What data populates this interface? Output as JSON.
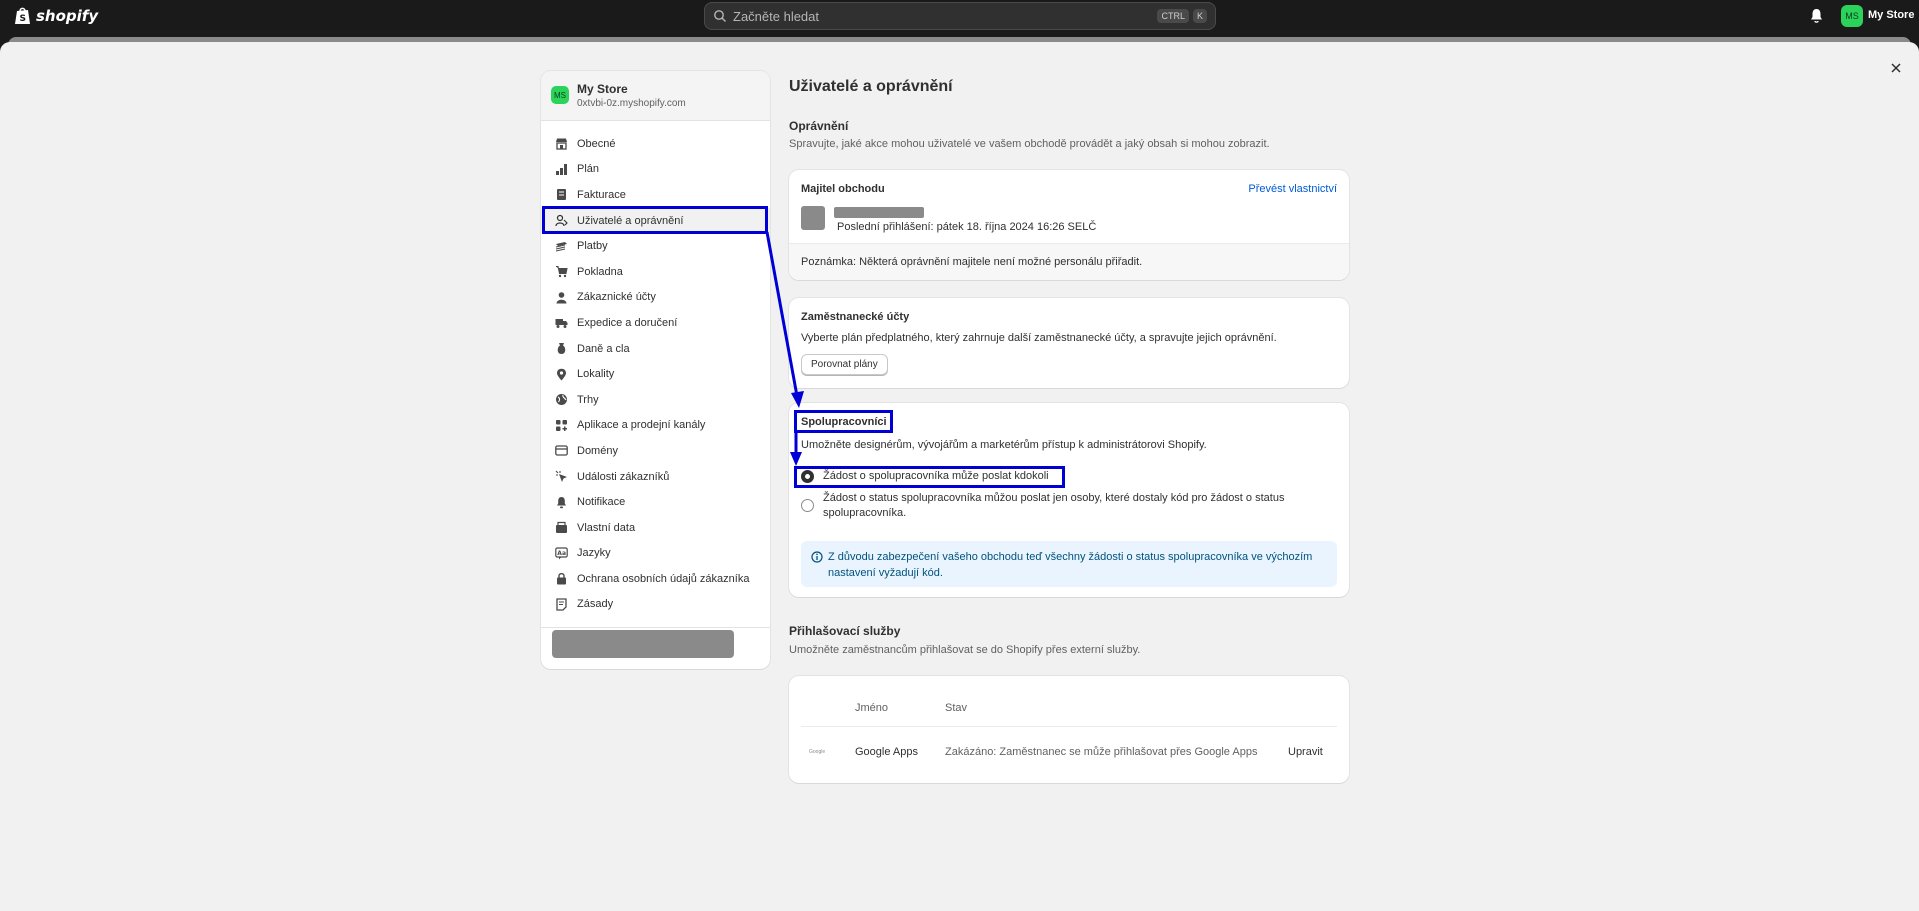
{
  "topbar": {
    "logo_text": "shopify",
    "search_placeholder": "Začněte hledat",
    "kbd_ctrl": "CTRL",
    "kbd_k": "K",
    "avatar_initials": "MS",
    "store_name": "My Store"
  },
  "sidebar": {
    "avatar_initials": "MS",
    "store_name": "My Store",
    "store_url": "0xtvbi-0z.myshopify.com",
    "items": [
      {
        "label": "Obecné",
        "icon": "store-icon"
      },
      {
        "label": "Plán",
        "icon": "plan-icon"
      },
      {
        "label": "Fakturace",
        "icon": "billing-icon"
      },
      {
        "label": "Uživatelé a oprávnění",
        "icon": "users-icon"
      },
      {
        "label": "Platby",
        "icon": "payments-icon"
      },
      {
        "label": "Pokladna",
        "icon": "cart-icon"
      },
      {
        "label": "Zákaznické účty",
        "icon": "person-icon"
      },
      {
        "label": "Expedice a doručení",
        "icon": "truck-icon"
      },
      {
        "label": "Daně a cla",
        "icon": "tax-icon"
      },
      {
        "label": "Lokality",
        "icon": "location-icon"
      },
      {
        "label": "Trhy",
        "icon": "globe-icon"
      },
      {
        "label": "Aplikace a prodejní kanály",
        "icon": "apps-icon"
      },
      {
        "label": "Domény",
        "icon": "domain-icon"
      },
      {
        "label": "Události zákazníků",
        "icon": "events-icon"
      },
      {
        "label": "Notifikace",
        "icon": "bell-icon"
      },
      {
        "label": "Vlastní data",
        "icon": "data-icon"
      },
      {
        "label": "Jazyky",
        "icon": "language-icon"
      },
      {
        "label": "Ochrana osobních údajů zákazníka",
        "icon": "lock-icon"
      },
      {
        "label": "Zásady",
        "icon": "policy-icon"
      }
    ]
  },
  "main": {
    "title": "Uživatelé a oprávnění",
    "permissions": {
      "title": "Oprávnění",
      "desc": "Spravujte, jaké akce mohou uživatelé ve vašem obchodě provádět a jaký obsah si mohou zobrazit."
    },
    "owner": {
      "title": "Majitel obchodu",
      "transfer_link": "Převést vlastnictví",
      "last_login": "Poslední přihlášení: pátek 18. října 2024 16:26 SELČ",
      "note": "Poznámka: Některá oprávnění majitele není možné personálu přiřadit."
    },
    "staff": {
      "title": "Zaměstnanecké účty",
      "desc": "Vyberte plán předplatného, který zahrnuje další zaměstnanecké účty, a spravujte jejich oprávnění.",
      "button": "Porovnat plány"
    },
    "collaborators": {
      "title": "Spolupracovníci",
      "desc": "Umožněte designérům, vývojářům a marketérům přístup k administrátorovi Shopify.",
      "option1": "Žádost o spolupracovníka může poslat kdokoli",
      "option2_line1": "Žádost o status spolupracovníka můžou poslat jen osoby, které dostaly kód pro žádost o status",
      "option2_line2": "spolupracovníka.",
      "info_line1": "Z důvodu zabezpečení vašeho obchodu teď všechny žádosti o status spolupracovníka ve výchozím",
      "info_line2": "nastavení vyžadují kód."
    },
    "login_services": {
      "title": "Přihlašovací služby",
      "desc": "Umožněte zaměstnancům přihlašovat se do Shopify přes externí služby.",
      "col_name": "Jméno",
      "col_status": "Stav",
      "row_logo_text": "Google",
      "row_name": "Google Apps",
      "row_status": "Zakázáno: Zaměstnanec se může přihlašovat přes Google Apps",
      "row_action": "Upravit"
    }
  },
  "colors": {
    "annotation": "#0000d6",
    "link": "#005bd3",
    "avatar": "#2bd35a"
  }
}
